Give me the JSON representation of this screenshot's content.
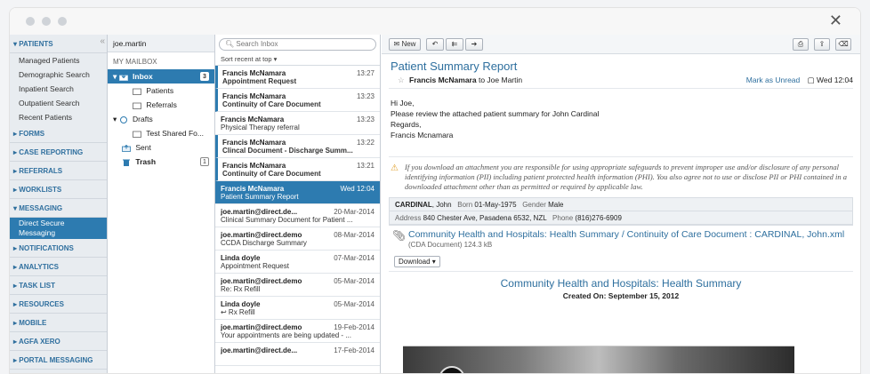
{
  "window": {
    "close_glyph": "✕"
  },
  "nav": {
    "sections": [
      {
        "label": "▾ PATIENTS",
        "items": [
          "Managed Patients",
          "Demographic Search",
          "Inpatient Search",
          "Outpatient Search",
          "Recent Patients"
        ]
      },
      {
        "label": "▸ FORMS"
      },
      {
        "label": "▸ CASE REPORTING"
      },
      {
        "label": "▸ REFERRALS"
      },
      {
        "label": "▸ WORKLISTS"
      },
      {
        "label": "▾ MESSAGING",
        "items": [
          "Direct Secure",
          "Messaging"
        ]
      },
      {
        "label": "▸ NOTIFICATIONS"
      },
      {
        "label": "▸ ANALYTICS"
      },
      {
        "label": "▸ TASK LIST"
      },
      {
        "label": "▸ RESOURCES"
      },
      {
        "label": "▸ MOBILE"
      },
      {
        "label": "▸ AGFA XERO"
      },
      {
        "label": "▸ PORTAL MESSAGING"
      }
    ]
  },
  "folders": {
    "user": "joe.martin",
    "mailbox_label": "MY MAILBOX",
    "items": [
      {
        "label": "Inbox",
        "badge": "3"
      },
      {
        "label": "Patients"
      },
      {
        "label": "Referrals"
      },
      {
        "label": "Drafts"
      },
      {
        "label": "Test Shared Fo..."
      },
      {
        "label": "Sent"
      },
      {
        "label": "Trash",
        "badge": "1"
      }
    ]
  },
  "list": {
    "search_placeholder": "Search Inbox",
    "sort_label": "Sort recent at top ▾",
    "messages": [
      {
        "from": "Francis McNamara",
        "subject": "Appointment Request",
        "time": "13:27"
      },
      {
        "from": "Francis McNamara",
        "subject": "Continuity of Care Document",
        "time": "13:23"
      },
      {
        "from": "Francis McNamara",
        "subject": "Physical Therapy referral",
        "time": "13:23"
      },
      {
        "from": "Francis McNamara",
        "subject": "Clincal Document - Discharge Summ...",
        "time": "13:22"
      },
      {
        "from": "Francis McNamara",
        "subject": "Continuity of Care Document",
        "time": "13:21"
      },
      {
        "from": "Francis McNamara",
        "subject": "Patient Summary Report",
        "time": "Wed 12:04"
      },
      {
        "from": "joe.martin@direct.de...",
        "subject": "Clinical Summary Document for Patient ...",
        "time": "20-Mar-2014"
      },
      {
        "from": "joe.martin@direct.demo",
        "subject": "CCDA Discharge Summary",
        "time": "08-Mar-2014"
      },
      {
        "from": "Linda doyle",
        "subject": "Appointment Request",
        "time": "07-Mar-2014"
      },
      {
        "from": "joe.martin@direct.demo",
        "subject": "Re: Rx Refill",
        "time": "05-Mar-2014"
      },
      {
        "from": "Linda doyle",
        "subject": "↩ Rx Refill",
        "time": "05-Mar-2014"
      },
      {
        "from": "joe.martin@direct.demo",
        "subject": "Your appointments are being updated - ...",
        "time": "19-Feb-2014"
      },
      {
        "from": "joe.martin@direct.de...",
        "subject": "",
        "time": "17-Feb-2014"
      }
    ]
  },
  "reader": {
    "toolbar": {
      "new_label": "New"
    },
    "title": "Patient Summary Report",
    "from": "Francis McNamara",
    "to_text": "to Joe Martin",
    "mark_unread": "Mark as Unread",
    "date": "Wed 12:04",
    "body": [
      "Hi Joe,",
      "Please review the attached patient summary for John Cardinal",
      "Regards,",
      "Francis Mcnamara"
    ],
    "warning": "If you download an attachment you are responsible for using appropriate safeguards to prevent improper use and/or disclosure of any personal identifying information (PII) including patient protected health information (PHI). You also agree not to use or disclose PII or PHI contained in a downloaded attachment other than as permitted or required by applicable law.",
    "patient": {
      "name": "CARDINAL",
      "first": ", John",
      "born_label": "Born",
      "born": "01-May-1975",
      "gender_label": "Gender",
      "gender": "Male",
      "address_label": "Address",
      "address": "840 Chester Ave, Pasadena 6532, NZL",
      "phone_label": "Phone",
      "phone": "(816)276-6909"
    },
    "attachment": {
      "link": "Community Health and Hospitals: Health Summary / Continuity of Care Document : CARDINAL, John.xml",
      "meta": "(CDA Document) 124.3 kB",
      "download_label": "Download ▾"
    },
    "doc_title": "Community Health and Hospitals: Health Summary",
    "doc_created": "Created On: September 15, 2012"
  }
}
